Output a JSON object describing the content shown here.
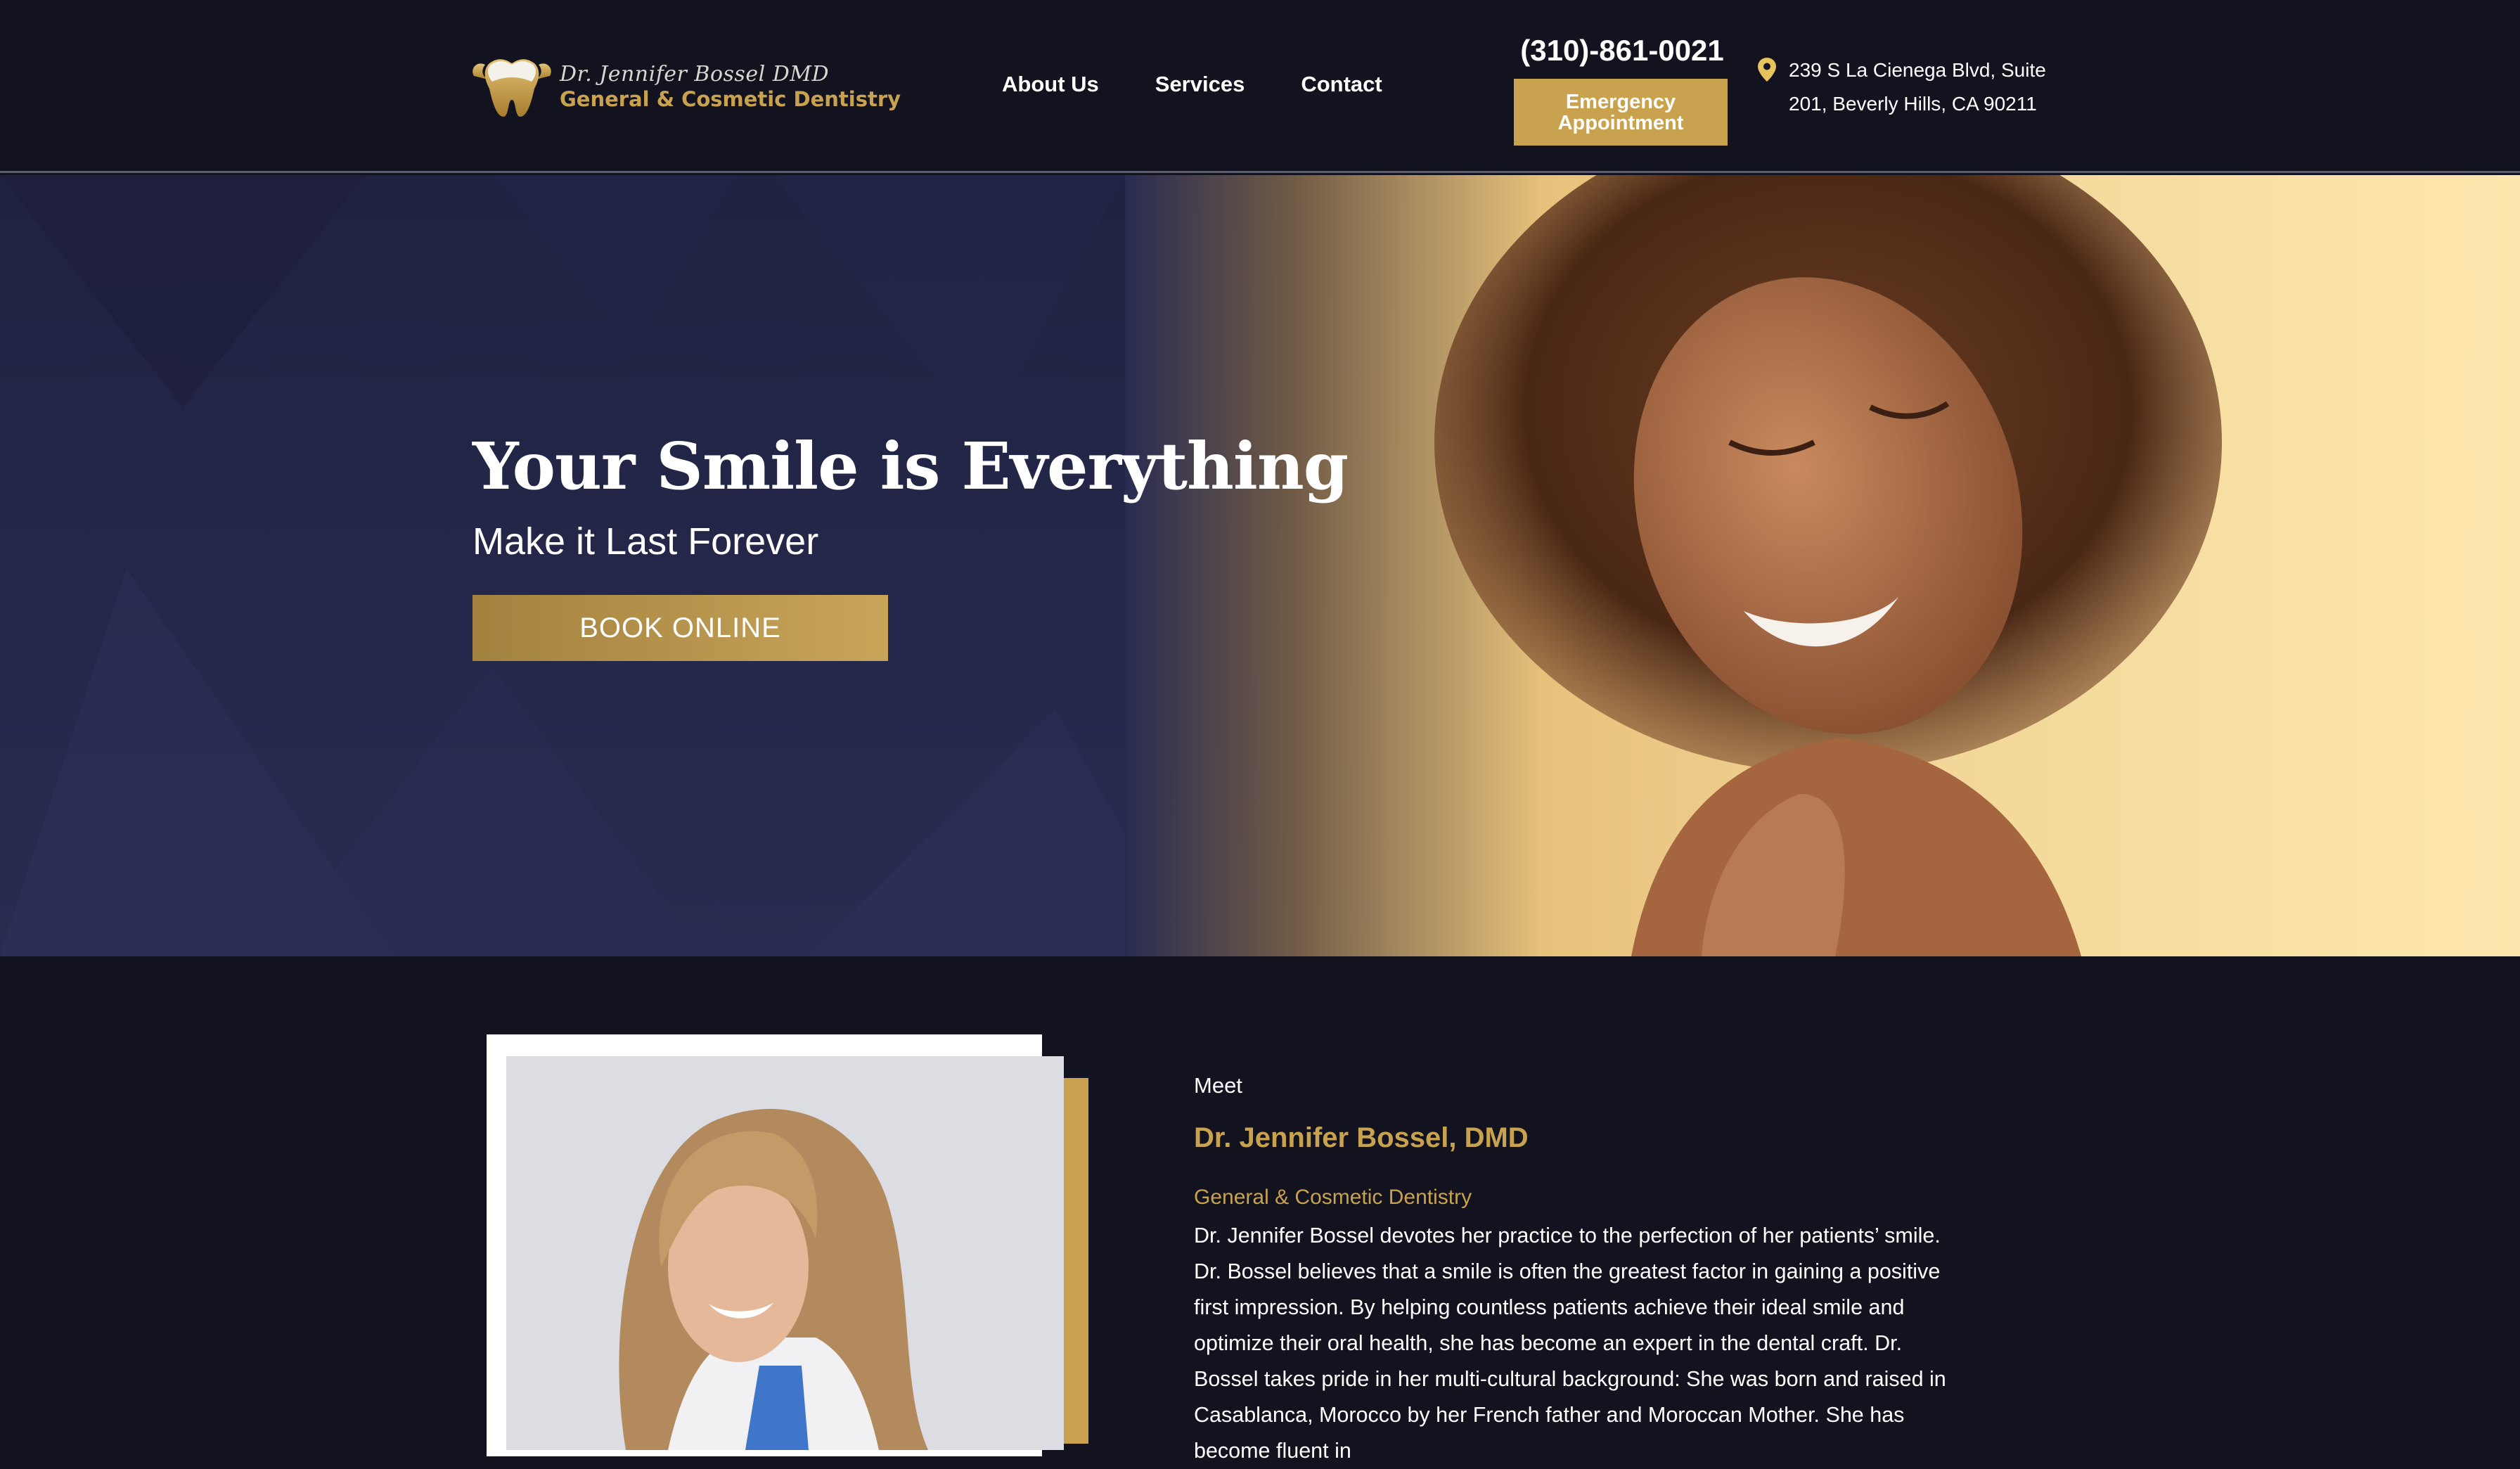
{
  "header": {
    "logo": {
      "line1": "Dr. Jennifer Bossel DMD",
      "line2": "General & Cosmetic Dentistry",
      "icon": "tooth-icon"
    },
    "nav": [
      {
        "label": "About Us"
      },
      {
        "label": "Services"
      },
      {
        "label": "Contact"
      }
    ],
    "phone": "(310)-861-0021",
    "emergency_button": {
      "line1": "Emergency",
      "line2": "Appointment"
    },
    "address": {
      "icon": "map-pin-icon",
      "line1": "239 S La Cienega Blvd, Suite",
      "line2": "201, Beverly Hills, CA 90211"
    }
  },
  "hero": {
    "title": "Your Smile is Everything",
    "subtitle": "Make it Last Forever",
    "book_button": "BOOK ONLINE"
  },
  "about": {
    "meet": "Meet",
    "name": "Dr. Jennifer Bossel, DMD",
    "specialty": "General & Cosmetic Dentistry",
    "bio": "Dr. Jennifer Bossel devotes her practice to the perfection of her patients’ smile. Dr. Bossel believes that a smile is often the greatest factor in gaining a positive first impression. By helping countless patients achieve their ideal smile and optimize their oral health, she has become an expert in the dental craft. Dr. Bossel takes pride in her multi-cultural background: She was born and raised in Casablanca, Morocco by her French father and Moroccan Mother. She has become fluent in"
  },
  "colors": {
    "background": "#12131f",
    "gold": "#c9a24f",
    "hero_navy": "#25284a"
  }
}
